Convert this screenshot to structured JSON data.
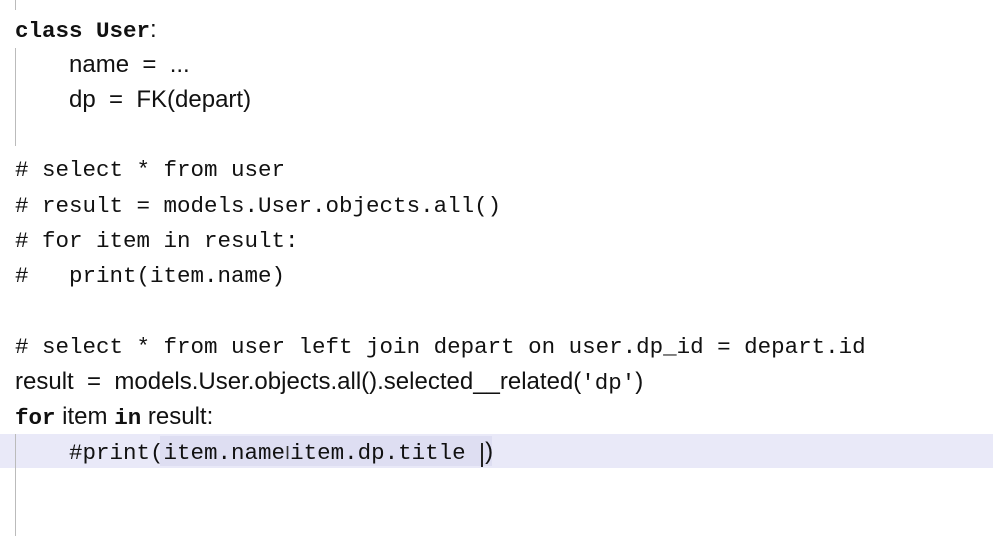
{
  "code": {
    "l1": [
      "class User",
      ":"
    ],
    "l2": [
      "name  =  ..."
    ],
    "l3": [
      "dp  =  FK(depart)"
    ],
    "l4": [
      "# select * from user"
    ],
    "l5": [
      "# result = models.User.objects.all()"
    ],
    "l6": [
      "# for item in result:"
    ],
    "l7": [
      "#   print(item.name)"
    ],
    "l8": [
      "# select * from user left join depart on user.dp_id = depart.id"
    ],
    "l9": [
      "result  =  models.User.objects.all().selected__related(",
      "'dp'",
      ")"
    ],
    "l10": [
      "for",
      " item ",
      "in",
      " result:"
    ],
    "l11": [
      "#print",
      "(item.name",
      "I",
      "item.dp.title ",
      ")"
    ]
  }
}
